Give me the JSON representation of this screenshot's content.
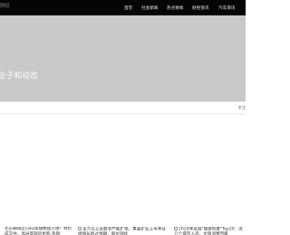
{
  "header": {
    "logo_text": "财经",
    "nav": [
      "首页",
      "社会新闻",
      "热点要闻",
      "财经资讯",
      "汽车资讯"
    ]
  },
  "hero": {
    "title": "全子和动态"
  },
  "strip": {
    "right_text": "关注"
  },
  "articles": [
    {
      "caption": "北京朝阳区CBD高端楼盘火爆！特价成交中，高层景观房抢购 热销"
    },
    {
      "caption": "全力以上全数字产能扩张，黄金矿业上半年业绩增长超过预期，股价持续"
    },
    {
      "caption": "2024年全国\"旅游热度\"Top20：这几个城市入选，文旅消费回暖"
    }
  ]
}
